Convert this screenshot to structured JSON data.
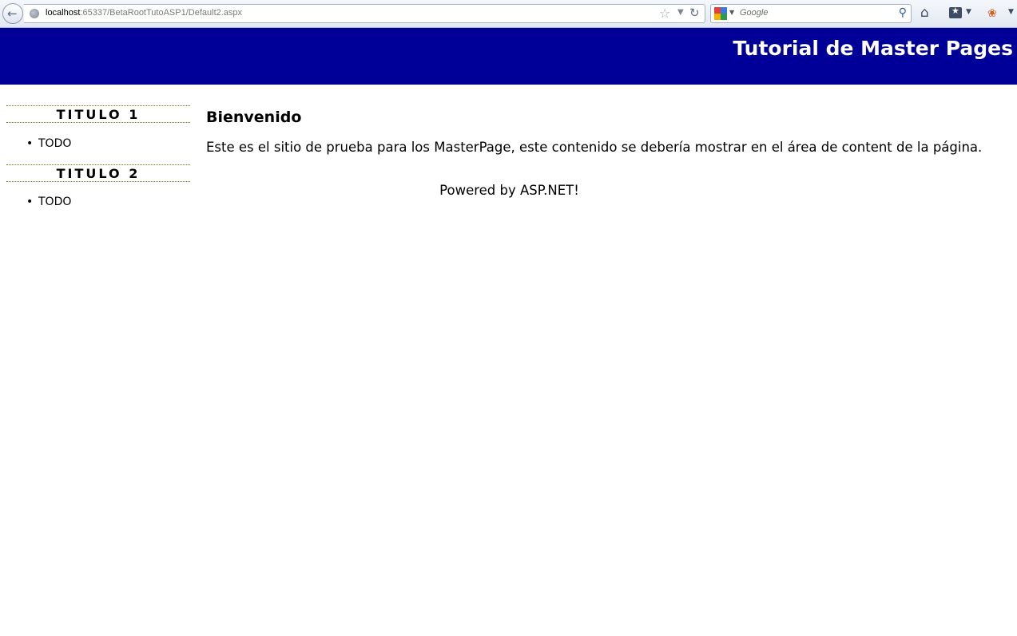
{
  "browser": {
    "url_host": "localhost",
    "url_rest": ":65337/BetaRootTutoASP1/Default2.aspx",
    "search_placeholder": "Google"
  },
  "header": {
    "title": "Tutorial de Master Pages"
  },
  "sidebar": {
    "sections": [
      {
        "title": "TITULO 1",
        "items": [
          "TODO"
        ]
      },
      {
        "title": "TITULO 2",
        "items": [
          "TODO"
        ]
      }
    ]
  },
  "main": {
    "heading": "Bienvenido",
    "body": "Este es el sitio de prueba para los MasterPage, este contenido se debería mostrar en el área de content de la página."
  },
  "footer": {
    "text": "Powered by ASP.NET!"
  },
  "colors": {
    "header_bg": "#000099",
    "header_text": "#ffffff"
  }
}
